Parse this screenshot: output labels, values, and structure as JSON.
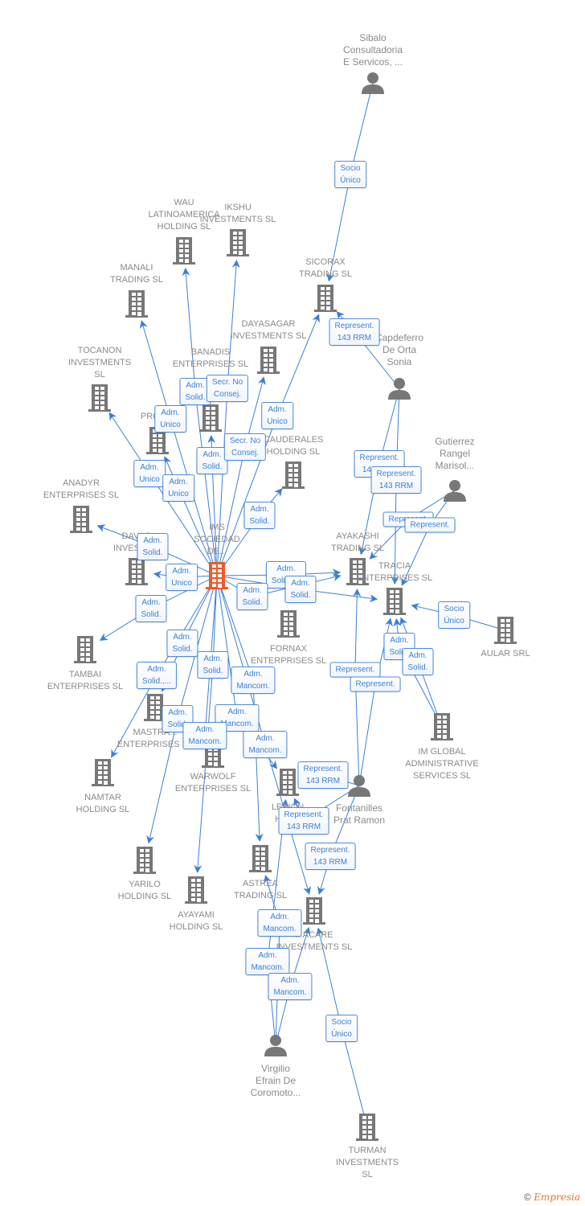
{
  "colors": {
    "edge": "#3b7fd4",
    "company": "#777777",
    "focus": "#f05a28",
    "person": "#777777"
  },
  "nodes": [
    {
      "id": "sibalo",
      "type": "person",
      "label": "Sibalo\nConsultadoria\nE Servicos, ..."
    },
    {
      "id": "wau",
      "type": "company",
      "label": "WAU\nLATINOAMERICA\nHOLDING SL"
    },
    {
      "id": "ikshu",
      "type": "company",
      "label": "IKSHU\nINVESTMENTS SL"
    },
    {
      "id": "manali",
      "type": "company",
      "label": "MANALI\nTRADING SL"
    },
    {
      "id": "sicorax",
      "type": "company",
      "label": "SICORAX\nTRADING SL"
    },
    {
      "id": "dayasagar",
      "type": "company",
      "label": "DAYASAGAR\nINVESTMENTS SL"
    },
    {
      "id": "banadis",
      "type": "company",
      "label": "BANADIS\nENTERPRISES SL"
    },
    {
      "id": "capdeferro",
      "type": "person",
      "label": "Capdeferro\nDe Orta\nSonia"
    },
    {
      "id": "tocanon",
      "type": "company",
      "label": "TOCANON\nINVESTMENTS\nSL"
    },
    {
      "id": "prom",
      "type": "company",
      "label": "PROM..."
    },
    {
      "id": "cauderales",
      "type": "company",
      "label": "CAUDERALES\nHOLDING SL"
    },
    {
      "id": "gutierrez",
      "type": "person",
      "label": "Gutierrez\nRangel\nMarisol..."
    },
    {
      "id": "anadyr",
      "type": "company",
      "label": "ANADYR\nENTERPRISES SL"
    },
    {
      "id": "ims",
      "type": "focus",
      "label": "IMS\nSOCIEDAD\nDE..."
    },
    {
      "id": "davao",
      "type": "company",
      "label": "DAVAO\nINVESTM..."
    },
    {
      "id": "ayakashi",
      "type": "company",
      "label": "AYAKASHI\nTRADING SL"
    },
    {
      "id": "tracia",
      "type": "company",
      "label": "TRACIA\nENTERPRISES SL"
    },
    {
      "id": "aular",
      "type": "company",
      "label": "AULAR SRL"
    },
    {
      "id": "fornax",
      "type": "company",
      "label": "FORNAX\nENTERPRISES SL"
    },
    {
      "id": "tambai",
      "type": "company",
      "label": "TAMBAI\nENTERPRISES SL"
    },
    {
      "id": "mastra",
      "type": "company",
      "label": "MASTRA...\nENTERPRISES SL"
    },
    {
      "id": "imglobal",
      "type": "company",
      "label": "IM GLOBAL\nADMINISTRATIVE\nSERVICES  SL"
    },
    {
      "id": "warwolf",
      "type": "company",
      "label": "WARWOLF\nENTERPRISES SL"
    },
    {
      "id": "namtar",
      "type": "company",
      "label": "NAMTAR\nHOLDING SL"
    },
    {
      "id": "lebion",
      "type": "company",
      "label": "LEBION\nHOL..."
    },
    {
      "id": "fontanilles",
      "type": "person",
      "label": "Fontanilles\nPrat Ramon"
    },
    {
      "id": "yarilo",
      "type": "company",
      "label": "YARILO\nHOLDING SL"
    },
    {
      "id": "astrea",
      "type": "company",
      "label": "ASTREA\nTRADING SL"
    },
    {
      "id": "ayayami",
      "type": "company",
      "label": "AYAYAMI\nHOLDING SL"
    },
    {
      "id": "acare",
      "type": "company",
      "label": "...ACARE\nINVESTMENTS SL"
    },
    {
      "id": "virgilio",
      "type": "person",
      "label": "Virgilio\nEfrain De\nCoromoto..."
    },
    {
      "id": "turman",
      "type": "company",
      "label": "TURMAN\nINVESTMENTS\nSL"
    }
  ],
  "edges": [
    {
      "from": "sibalo",
      "to": "sicorax",
      "label": "Socio\nÚnico"
    },
    {
      "from": "ims",
      "to": "wau",
      "label": "Adm.\nSolid."
    },
    {
      "from": "ims",
      "to": "ikshu",
      "label": "Secr.  No\nConsej."
    },
    {
      "from": "ims",
      "to": "manali",
      "label": "Adm.\nUnico"
    },
    {
      "from": "ims",
      "to": "banadis",
      "label": "Adm.\nSolid."
    },
    {
      "from": "ims",
      "to": "dayasagar",
      "label": "Secr.  No\nConsej."
    },
    {
      "from": "ims",
      "to": "sicorax",
      "label": "Adm.\nUnico"
    },
    {
      "from": "ims",
      "to": "tocanon",
      "label": "Adm.\nUnico"
    },
    {
      "from": "ims",
      "to": "prom",
      "label": "Adm.\nUnico"
    },
    {
      "from": "ims",
      "to": "cauderales",
      "label": "Adm.\nSolid."
    },
    {
      "from": "ims",
      "to": "anadyr",
      "label": "Adm.\nSolid."
    },
    {
      "from": "ims",
      "to": "davao",
      "label": "Adm.\nUnico"
    },
    {
      "from": "ims",
      "to": "tambai",
      "label": "Adm.\nSolid."
    },
    {
      "from": "ims",
      "to": "ayakashi",
      "label": "Adm.\nSolid.,..."
    },
    {
      "from": "ims",
      "to": "ayakashi",
      "label": "Adm.\nSolid."
    },
    {
      "from": "ims",
      "to": "tracia",
      "label": "Adm.\nSolid."
    },
    {
      "from": "ims",
      "to": "mastra",
      "label": "Adm.\nSolid."
    },
    {
      "from": "ims",
      "to": "namtar",
      "label": "Adm.\nSolid.,..."
    },
    {
      "from": "ims",
      "to": "ayayami",
      "label": "Adm.\nSolid."
    },
    {
      "from": "ims",
      "to": "yarilo",
      "label": "Adm.\nSolid."
    },
    {
      "from": "ims",
      "to": "astrea",
      "label": "Adm.\nMancom."
    },
    {
      "from": "ims",
      "to": "lebion",
      "label": "Adm.\nMancom."
    },
    {
      "from": "ims",
      "to": "warwolf",
      "label": "Adm.\nMancom."
    },
    {
      "from": "ims",
      "to": "acare",
      "label": "Adm.\nMancom."
    },
    {
      "from": "capdeferro",
      "to": "sicorax",
      "label": "Represent.\n143 RRM"
    },
    {
      "from": "capdeferro",
      "to": "ayakashi",
      "label": "Represent.\n143 RRM"
    },
    {
      "from": "capdeferro",
      "to": "tracia",
      "label": "Represent.\n143 RRM"
    },
    {
      "from": "gutierrez",
      "to": "ayakashi",
      "label": "Represent."
    },
    {
      "from": "gutierrez",
      "to": "tracia",
      "label": "Represent."
    },
    {
      "from": "aular",
      "to": "tracia",
      "label": "Socio\nÚnico"
    },
    {
      "from": "imglobal",
      "to": "tracia",
      "label": "Adm.\nSolid."
    },
    {
      "from": "imglobal",
      "to": "tracia",
      "label": "Adm.\nSolid."
    },
    {
      "from": "fontanilles",
      "to": "ayakashi",
      "label": "Represent."
    },
    {
      "from": "fontanilles",
      "to": "tracia",
      "label": "Represent."
    },
    {
      "from": "fontanilles",
      "to": "lebion",
      "label": "Represent.\n143 RRM"
    },
    {
      "from": "fontanilles",
      "to": "lebion",
      "label": "Represent.\n143 RRM"
    },
    {
      "from": "fontanilles",
      "to": "acare",
      "label": "Represent.\n143 RRM"
    },
    {
      "from": "virgilio",
      "to": "astrea",
      "label": "Adm.\nMancom."
    },
    {
      "from": "virgilio",
      "to": "lebion",
      "label": "Adm.\nMancom."
    },
    {
      "from": "virgilio",
      "to": "acare",
      "label": "Adm.\nMancom."
    },
    {
      "from": "turman",
      "to": "acare",
      "label": "Socio\nÚnico"
    }
  ],
  "footer": {
    "copyright": "©",
    "brand": "Empresia"
  }
}
